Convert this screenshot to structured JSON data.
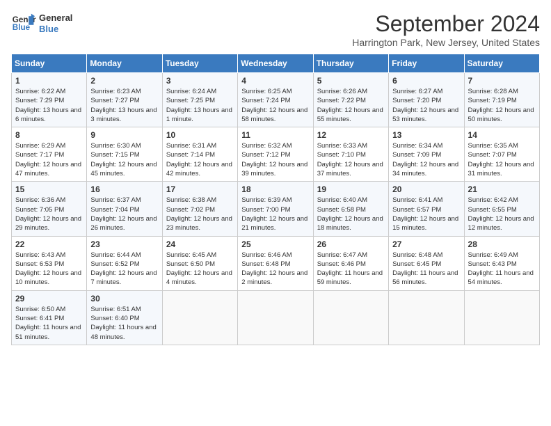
{
  "logo": {
    "line1": "General",
    "line2": "Blue"
  },
  "title": "September 2024",
  "subtitle": "Harrington Park, New Jersey, United States",
  "days_of_week": [
    "Sunday",
    "Monday",
    "Tuesday",
    "Wednesday",
    "Thursday",
    "Friday",
    "Saturday"
  ],
  "weeks": [
    [
      {
        "num": "1",
        "sunrise": "6:22 AM",
        "sunset": "7:29 PM",
        "daylight": "13 hours and 6 minutes."
      },
      {
        "num": "2",
        "sunrise": "6:23 AM",
        "sunset": "7:27 PM",
        "daylight": "13 hours and 3 minutes."
      },
      {
        "num": "3",
        "sunrise": "6:24 AM",
        "sunset": "7:25 PM",
        "daylight": "13 hours and 1 minute."
      },
      {
        "num": "4",
        "sunrise": "6:25 AM",
        "sunset": "7:24 PM",
        "daylight": "12 hours and 58 minutes."
      },
      {
        "num": "5",
        "sunrise": "6:26 AM",
        "sunset": "7:22 PM",
        "daylight": "12 hours and 55 minutes."
      },
      {
        "num": "6",
        "sunrise": "6:27 AM",
        "sunset": "7:20 PM",
        "daylight": "12 hours and 53 minutes."
      },
      {
        "num": "7",
        "sunrise": "6:28 AM",
        "sunset": "7:19 PM",
        "daylight": "12 hours and 50 minutes."
      }
    ],
    [
      {
        "num": "8",
        "sunrise": "6:29 AM",
        "sunset": "7:17 PM",
        "daylight": "12 hours and 47 minutes."
      },
      {
        "num": "9",
        "sunrise": "6:30 AM",
        "sunset": "7:15 PM",
        "daylight": "12 hours and 45 minutes."
      },
      {
        "num": "10",
        "sunrise": "6:31 AM",
        "sunset": "7:14 PM",
        "daylight": "12 hours and 42 minutes."
      },
      {
        "num": "11",
        "sunrise": "6:32 AM",
        "sunset": "7:12 PM",
        "daylight": "12 hours and 39 minutes."
      },
      {
        "num": "12",
        "sunrise": "6:33 AM",
        "sunset": "7:10 PM",
        "daylight": "12 hours and 37 minutes."
      },
      {
        "num": "13",
        "sunrise": "6:34 AM",
        "sunset": "7:09 PM",
        "daylight": "12 hours and 34 minutes."
      },
      {
        "num": "14",
        "sunrise": "6:35 AM",
        "sunset": "7:07 PM",
        "daylight": "12 hours and 31 minutes."
      }
    ],
    [
      {
        "num": "15",
        "sunrise": "6:36 AM",
        "sunset": "7:05 PM",
        "daylight": "12 hours and 29 minutes."
      },
      {
        "num": "16",
        "sunrise": "6:37 AM",
        "sunset": "7:04 PM",
        "daylight": "12 hours and 26 minutes."
      },
      {
        "num": "17",
        "sunrise": "6:38 AM",
        "sunset": "7:02 PM",
        "daylight": "12 hours and 23 minutes."
      },
      {
        "num": "18",
        "sunrise": "6:39 AM",
        "sunset": "7:00 PM",
        "daylight": "12 hours and 21 minutes."
      },
      {
        "num": "19",
        "sunrise": "6:40 AM",
        "sunset": "6:58 PM",
        "daylight": "12 hours and 18 minutes."
      },
      {
        "num": "20",
        "sunrise": "6:41 AM",
        "sunset": "6:57 PM",
        "daylight": "12 hours and 15 minutes."
      },
      {
        "num": "21",
        "sunrise": "6:42 AM",
        "sunset": "6:55 PM",
        "daylight": "12 hours and 12 minutes."
      }
    ],
    [
      {
        "num": "22",
        "sunrise": "6:43 AM",
        "sunset": "6:53 PM",
        "daylight": "12 hours and 10 minutes."
      },
      {
        "num": "23",
        "sunrise": "6:44 AM",
        "sunset": "6:52 PM",
        "daylight": "12 hours and 7 minutes."
      },
      {
        "num": "24",
        "sunrise": "6:45 AM",
        "sunset": "6:50 PM",
        "daylight": "12 hours and 4 minutes."
      },
      {
        "num": "25",
        "sunrise": "6:46 AM",
        "sunset": "6:48 PM",
        "daylight": "12 hours and 2 minutes."
      },
      {
        "num": "26",
        "sunrise": "6:47 AM",
        "sunset": "6:46 PM",
        "daylight": "11 hours and 59 minutes."
      },
      {
        "num": "27",
        "sunrise": "6:48 AM",
        "sunset": "6:45 PM",
        "daylight": "11 hours and 56 minutes."
      },
      {
        "num": "28",
        "sunrise": "6:49 AM",
        "sunset": "6:43 PM",
        "daylight": "11 hours and 54 minutes."
      }
    ],
    [
      {
        "num": "29",
        "sunrise": "6:50 AM",
        "sunset": "6:41 PM",
        "daylight": "11 hours and 51 minutes."
      },
      {
        "num": "30",
        "sunrise": "6:51 AM",
        "sunset": "6:40 PM",
        "daylight": "11 hours and 48 minutes."
      },
      null,
      null,
      null,
      null,
      null
    ]
  ]
}
